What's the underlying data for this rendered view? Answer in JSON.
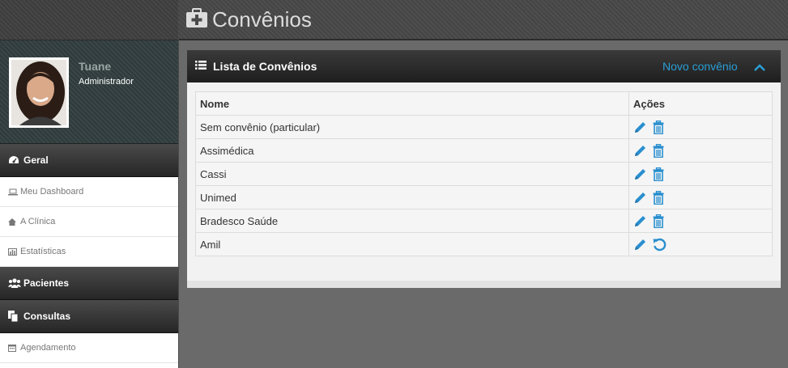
{
  "header": {
    "title": "Convênios",
    "icon": "medkit-icon"
  },
  "profile": {
    "name": "Tuane",
    "role": "Administrador"
  },
  "sidebar": {
    "sections": [
      {
        "label": "Geral",
        "icon": "dashboard-icon",
        "items": [
          {
            "label": "Meu Dashboard",
            "icon": "laptop-icon"
          },
          {
            "label": "A Clínica",
            "icon": "home-icon"
          },
          {
            "label": "Estatísticas",
            "icon": "bar-chart-icon"
          }
        ]
      },
      {
        "label": "Pacientes",
        "icon": "group-icon",
        "items": []
      },
      {
        "label": "Consultas",
        "icon": "copy-icon",
        "items": [
          {
            "label": "Agendamento",
            "icon": "calendar-icon"
          }
        ]
      }
    ]
  },
  "panel": {
    "title": "Lista de Convênios",
    "new_link": "Novo convênio",
    "columns": {
      "name": "Nome",
      "actions": "Ações"
    },
    "rows": [
      {
        "name": "Sem convênio (particular)",
        "secondary_action": "delete"
      },
      {
        "name": "Assimédica",
        "secondary_action": "delete"
      },
      {
        "name": "Cassi",
        "secondary_action": "delete"
      },
      {
        "name": "Unimed",
        "secondary_action": "delete"
      },
      {
        "name": "Bradesco Saúde",
        "secondary_action": "delete"
      },
      {
        "name": "Amil",
        "secondary_action": "restore"
      }
    ]
  },
  "colors": {
    "accent": "#2a9fd6",
    "panel_head": "#262626",
    "sidebar_section": "#3a3a3a"
  }
}
